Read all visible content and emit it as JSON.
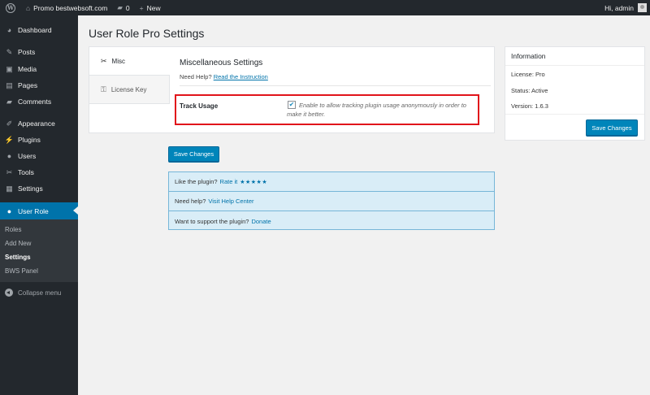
{
  "adminbar": {
    "site_name": "Promo bestwebsoft.com",
    "comments_count": "0",
    "new_label": "New",
    "greeting": "Hi, admin"
  },
  "sidebar": {
    "items": [
      {
        "label": "Dashboard",
        "icon": "dashboard-icon"
      },
      {
        "label": "Posts",
        "icon": "pin-icon"
      },
      {
        "label": "Media",
        "icon": "media-icon"
      },
      {
        "label": "Pages",
        "icon": "page-icon"
      },
      {
        "label": "Comments",
        "icon": "comment-icon"
      },
      {
        "label": "Appearance",
        "icon": "brush-icon"
      },
      {
        "label": "Plugins",
        "icon": "plug-icon"
      },
      {
        "label": "Users",
        "icon": "users-icon"
      },
      {
        "label": "Tools",
        "icon": "wrench-icon"
      },
      {
        "label": "Settings",
        "icon": "settings-icon"
      },
      {
        "label": "User Role",
        "icon": "user-icon"
      }
    ],
    "submenu": [
      "Roles",
      "Add New",
      "Settings",
      "BWS Panel"
    ],
    "collapse_label": "Collapse menu",
    "accent_color": "#0073aa"
  },
  "page": {
    "title": "User Role Pro Settings"
  },
  "tabs": [
    {
      "label": "Misc",
      "icon": "wrench-icon"
    },
    {
      "label": "License Key",
      "icon": "key-icon"
    }
  ],
  "misc": {
    "heading": "Miscellaneous Settings",
    "help_prefix": "Need Help?",
    "help_link": "Read the Instruction",
    "track_label": "Track Usage",
    "track_checked": true,
    "track_desc": "Enable to allow tracking plugin usage anonymously in order to make it better.",
    "save_label": "Save Changes",
    "highlight_color": "#e1141b"
  },
  "info": {
    "title": "Information",
    "license": "License: Pro",
    "status": "Status: Active",
    "version": "Version: 1.6.3",
    "save_label": "Save Changes"
  },
  "promo": {
    "rate_prefix": "Like the plugin?",
    "rate_link": "Rate it",
    "stars": "★★★★★",
    "help_prefix": "Need help?",
    "help_link": "Visit Help Center",
    "support_prefix": "Want to support the plugin?",
    "support_link": "Donate"
  }
}
